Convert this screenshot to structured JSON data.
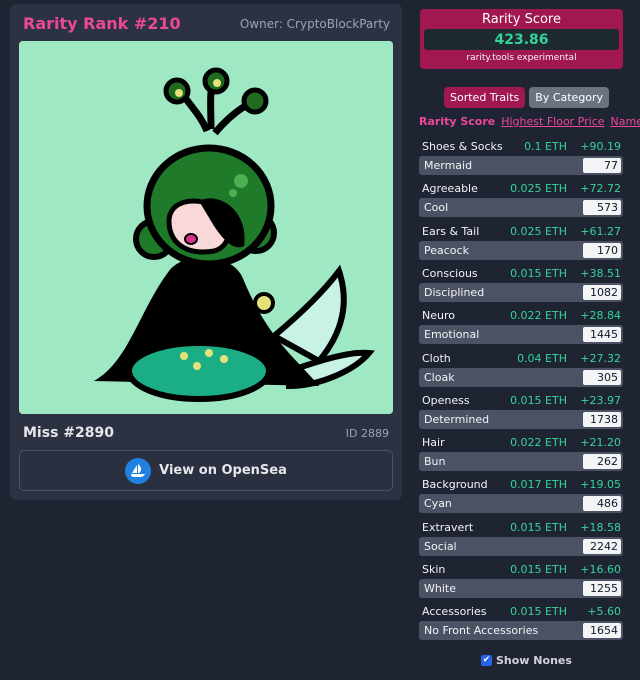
{
  "card": {
    "rank_label": "Rarity Rank #210",
    "owner_label": "Owner: CryptoBlockParty",
    "nft_name": "Miss #2890",
    "nft_id": "ID 2889",
    "opensea_label": "View on OpenSea"
  },
  "score": {
    "title": "Rarity Score",
    "value": "423.86",
    "subtitle": "rarity.tools experimental"
  },
  "sort_buttons": [
    "Sorted Traits",
    "By Category"
  ],
  "sort_links": [
    "Rarity Score",
    "Highest Floor Price",
    "Name"
  ],
  "traits": [
    {
      "category": "Shoes & Socks",
      "floor": "0.1 ETH",
      "score": "+90.19",
      "value": "Mermaid",
      "count": "77"
    },
    {
      "category": "Agreeable",
      "floor": "0.025 ETH",
      "score": "+72.72",
      "value": "Cool",
      "count": "573"
    },
    {
      "category": "Ears & Tail",
      "floor": "0.025 ETH",
      "score": "+61.27",
      "value": "Peacock",
      "count": "170"
    },
    {
      "category": "Conscious",
      "floor": "0.015 ETH",
      "score": "+38.51",
      "value": "Disciplined",
      "count": "1082"
    },
    {
      "category": "Neuro",
      "floor": "0.022 ETH",
      "score": "+28.84",
      "value": "Emotional",
      "count": "1445"
    },
    {
      "category": "Cloth",
      "floor": "0.04 ETH",
      "score": "+27.32",
      "value": "Cloak",
      "count": "305"
    },
    {
      "category": "Openess",
      "floor": "0.015 ETH",
      "score": "+23.97",
      "value": "Determined",
      "count": "1738"
    },
    {
      "category": "Hair",
      "floor": "0.022 ETH",
      "score": "+21.20",
      "value": "Bun",
      "count": "262"
    },
    {
      "category": "Background",
      "floor": "0.017 ETH",
      "score": "+19.05",
      "value": "Cyan",
      "count": "486"
    },
    {
      "category": "Extravert",
      "floor": "0.015 ETH",
      "score": "+18.58",
      "value": "Social",
      "count": "2242"
    },
    {
      "category": "Skin",
      "floor": "0.015 ETH",
      "score": "+16.60",
      "value": "White",
      "count": "1255"
    },
    {
      "category": "Accessories",
      "floor": "0.015 ETH",
      "score": "+5.60",
      "value": "No Front Accessories",
      "count": "1654"
    }
  ],
  "show_nones_label": "Show Nones",
  "show_nones_checked": true,
  "colors": {
    "accent": "#a0184f",
    "pink_text": "#ec4899",
    "green_text": "#34d399",
    "image_bg": "#9fe8c4",
    "opensea_blue": "#2081e2"
  },
  "icons": {
    "opensea": "opensea-ship-icon",
    "checkbox": "checkmark-icon"
  }
}
